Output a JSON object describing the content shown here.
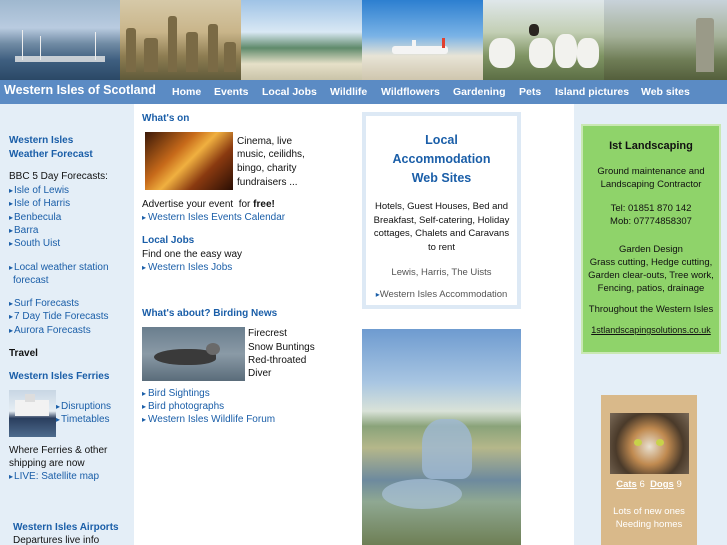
{
  "site_title": "Western Isles of Scotland",
  "nav": [
    "Home",
    "Events",
    "Local Jobs",
    "Wildlife",
    "Wildflowers",
    "Gardening",
    "Pets",
    "Island pictures",
    "Web sites"
  ],
  "left": {
    "weather_heading_1": "Western Isles",
    "weather_heading_2": "Weather Forecast",
    "bbc_label": "BBC 5 Day Forecasts:",
    "forecast_links": [
      "Isle of Lewis",
      "Isle of Harris",
      "Benbecula",
      "Barra",
      "South Uist"
    ],
    "local_weather_1": "Local weather station",
    "local_weather_2": "forecast",
    "other_links": [
      "Surf Forecasts",
      "7 Day Tide Forecasts",
      "Aurora Forecasts"
    ],
    "travel_label": "Travel",
    "ferries_heading": "Western Isles Ferries",
    "ferry_links": [
      "Disruptions",
      "Timetables"
    ],
    "ferries_text_1": "Where Ferries & other",
    "ferries_text_2": "shipping are now",
    "satellite_link": "LIVE: Satellite map",
    "airports_heading": "Western Isles Airports",
    "departures_text": "Departures live info"
  },
  "center": {
    "whats_on_heading": "What's on",
    "whats_on_text": [
      "Cinema, live",
      "music, ceilidhs,",
      "bingo, charity",
      "fundraisers ..."
    ],
    "advertise_text": "Advertise your event  for ",
    "advertise_free": "free!",
    "events_link": "Western Isles Events Calendar",
    "jobs_heading": "Local Jobs",
    "jobs_text": "Find one the easy way",
    "jobs_link": "Western Isles Jobs",
    "birding_heading": "What's about? Birding News",
    "birding_text": [
      "Firecrest",
      "Snow Buntings",
      "Red-throated",
      "Diver"
    ],
    "bird_links": [
      "Bird Sightings",
      "Bird photographs",
      "Western Isles Wildlife Forum"
    ]
  },
  "accommodation": {
    "title_lines": [
      "Local",
      "Accommodation",
      "Web Sites"
    ],
    "desc_lines": [
      "Hotels, Guest Houses, Bed and",
      "Breakfast, Self-catering, Holiday",
      "cottages, Chalets and Caravans",
      "to rent"
    ],
    "areas": "Lewis, Harris, The Uists",
    "link": "Western Isles Accommodation"
  },
  "landscaping": {
    "title": "Ist Landscaping",
    "lines_1": [
      "Ground maintenance and",
      "Landscaping Contractor"
    ],
    "tel": "Tel: 01851 870 142",
    "mob": "Mob: 07774858307",
    "lines_2": [
      "Garden Design",
      "Grass cutting, Hedge cutting,",
      "Garden clear-outs, Tree work,",
      "Fencing, patios, drainage"
    ],
    "area": "Throughout the Western Isles",
    "website": "1stlandscapingsolutions.co.uk"
  },
  "pets": {
    "cats_label": "Cats",
    "cats_count": "6",
    "dogs_label": "Dogs",
    "dogs_count": "9",
    "text_lines": [
      "Lots of new ones",
      "Needing homes"
    ]
  },
  "colors": {
    "nav_bg": "#5b8bc4",
    "link": "#1a5ea8",
    "sidebar_bg": "#e4eef7",
    "landscaping_bg": "#8fd36a",
    "pets_bg": "#d9b98a"
  }
}
